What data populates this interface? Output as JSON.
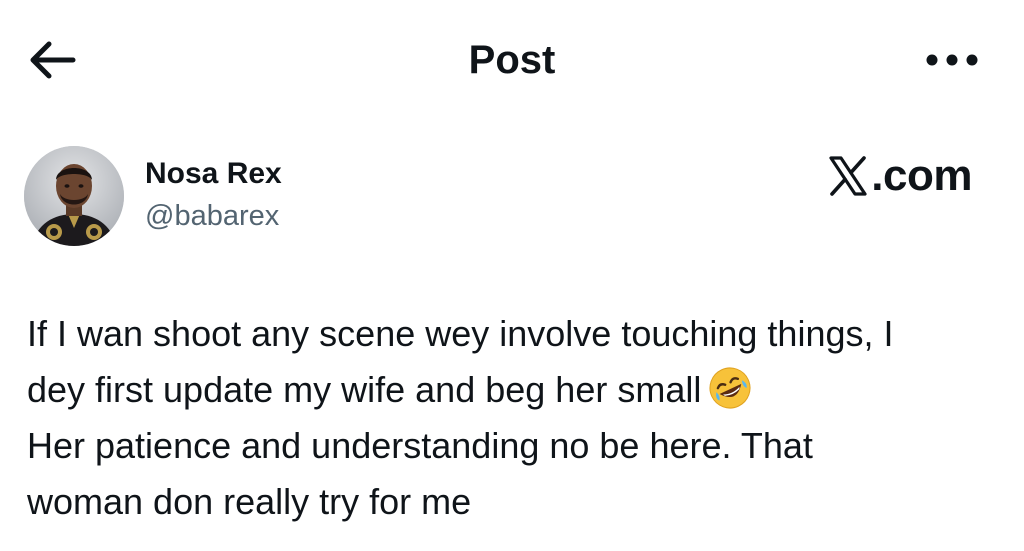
{
  "header": {
    "title": "Post",
    "back_icon": "arrow-left-icon",
    "more_icon": "more-horizontal-icon"
  },
  "author": {
    "display_name": "Nosa Rex",
    "handle": "@babarex",
    "avatar": "avatar-photo"
  },
  "brand": {
    "logo_icon": "x-logo-icon",
    "text": ".com"
  },
  "post": {
    "lines": [
      "If I wan shoot any scene wey involve touching things, I",
      "dey first update my wife and beg her small",
      "Her patience and understanding no be here. That",
      "woman don really try for me"
    ],
    "emoji": "rolling-on-the-floor-laughing-emoji"
  },
  "colors": {
    "text": "#0f1419",
    "secondary_text": "#536471",
    "background": "#ffffff",
    "emoji_yellow": "#f7c23a"
  }
}
